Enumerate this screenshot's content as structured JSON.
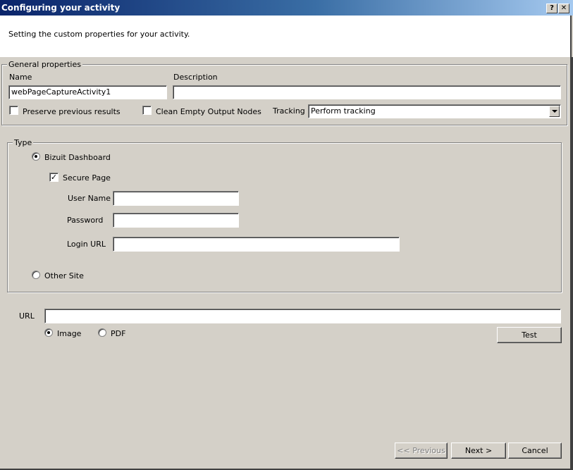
{
  "window": {
    "title": "Configuring your activity",
    "help_glyph": "?",
    "close_glyph": "✕"
  },
  "header": {
    "subtitle": "Setting the custom properties for your activity."
  },
  "general": {
    "legend": "General properties",
    "name_label": "Name",
    "name_value": "webPageCaptureActivity1",
    "description_label": "Description",
    "description_value": "",
    "preserve_label": "Preserve previous results",
    "preserve_checked": false,
    "clean_label": "Clean Empty Output Nodes",
    "clean_checked": false,
    "tracking_label": "Tracking",
    "tracking_value": "Perform tracking"
  },
  "type": {
    "legend": "Type",
    "bizuit_label": "Bizuit Dashboard",
    "bizuit_selected": true,
    "secure_label": "Secure Page",
    "secure_checked": true,
    "secure_check_glyph": "✓",
    "username_label": "User Name",
    "username_value": "",
    "password_label": "Password",
    "password_value": "",
    "login_url_label": "Login URL",
    "login_url_value": "",
    "other_label": "Other Site",
    "other_selected": false
  },
  "url": {
    "label": "URL",
    "value": "",
    "image_label": "Image",
    "image_selected": true,
    "pdf_label": "PDF",
    "pdf_selected": false,
    "test_label": "Test"
  },
  "footer": {
    "previous_label": "<< Previous",
    "next_label": "Next >",
    "cancel_label": "Cancel"
  }
}
